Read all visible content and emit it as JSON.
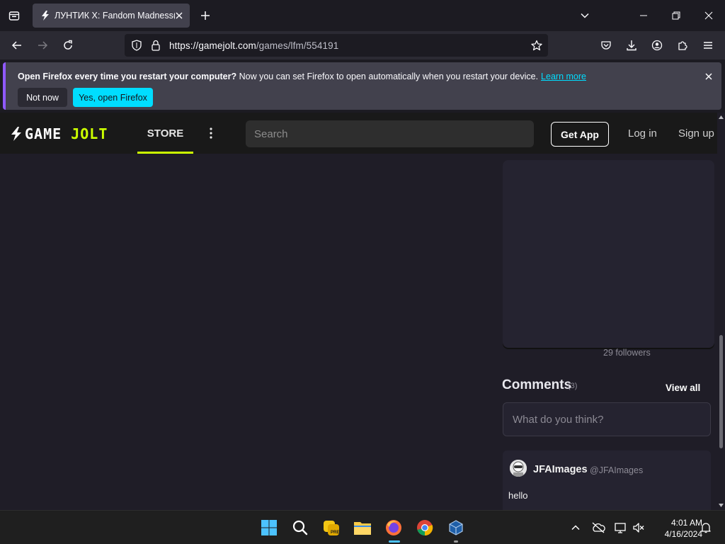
{
  "browser": {
    "tab_title": "ЛУНТИК X: Fandom Madness(",
    "url_host": "https://gamejolt.com",
    "url_path": "/games/lfm/554191"
  },
  "notification": {
    "bold": "Open Firefox every time you restart your computer?",
    "text": "Now you can set Firefox to open automatically when you restart your device.",
    "link": "Learn more",
    "not_now": "Not now",
    "yes": "Yes, open Firefox",
    "accent": "#00ddff"
  },
  "gamejolt": {
    "logo_game": "GAME",
    "logo_jolt": "JOLT",
    "store": "STORE",
    "search_placeholder": "Search",
    "get_app": "Get App",
    "log_in": "Log in",
    "sign_up": "Sign up",
    "accent": "#ccff00",
    "followers": "29 followers",
    "comments_title": "Comments",
    "comments_count": "(3)",
    "view_all": "View all",
    "comment_placeholder": "What do you think?",
    "comment": {
      "name": "JFAImages",
      "handle": "@JFAImages",
      "text": "hello"
    }
  },
  "taskbar": {
    "time": "4:01 AM",
    "date": "4/16/2024"
  }
}
